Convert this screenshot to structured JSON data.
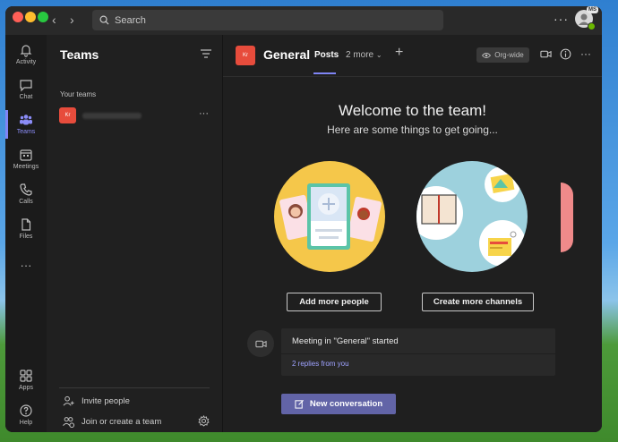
{
  "window": {
    "search": {
      "placeholder": "Search"
    },
    "more_label": "···",
    "profile": {
      "badge": "MS"
    }
  },
  "rail": {
    "items": [
      {
        "label": "Activity",
        "icon": "bell-icon"
      },
      {
        "label": "Chat",
        "icon": "chat-icon"
      },
      {
        "label": "Teams",
        "icon": "teams-icon",
        "active": true
      },
      {
        "label": "Meetings",
        "icon": "calendar-icon"
      },
      {
        "label": "Calls",
        "icon": "phone-icon"
      },
      {
        "label": "Files",
        "icon": "file-icon"
      },
      {
        "label": "···",
        "icon": "more-icon"
      }
    ],
    "bottom": [
      {
        "label": "Apps",
        "icon": "apps-icon"
      },
      {
        "label": "Help",
        "icon": "help-icon"
      }
    ]
  },
  "teams_panel": {
    "title": "Teams",
    "section_label": "Your teams",
    "team": {
      "initials": "Kr"
    },
    "team_more": "···",
    "invite_label": "Invite people",
    "join_label": "Join or create a team"
  },
  "channel": {
    "initials": "Kr",
    "name": "General",
    "tabs": {
      "posts": "Posts",
      "more": "2 more"
    },
    "add_tab": "+",
    "org_wide": "Org-wide",
    "more": "···"
  },
  "welcome": {
    "title": "Welcome to the team!",
    "subtitle": "Here are some things to get going...",
    "add_people": "Add more people",
    "create_channels": "Create more channels"
  },
  "feed": {
    "meeting_text": "Meeting in \"General\" started",
    "replies": "2 replies from you"
  },
  "compose": {
    "new_conversation": "New conversation"
  },
  "colors": {
    "accent": "#6264a7",
    "accent_light": "#7f85f5",
    "team_tile": "#e74c3c",
    "status_available": "#6bb700"
  }
}
